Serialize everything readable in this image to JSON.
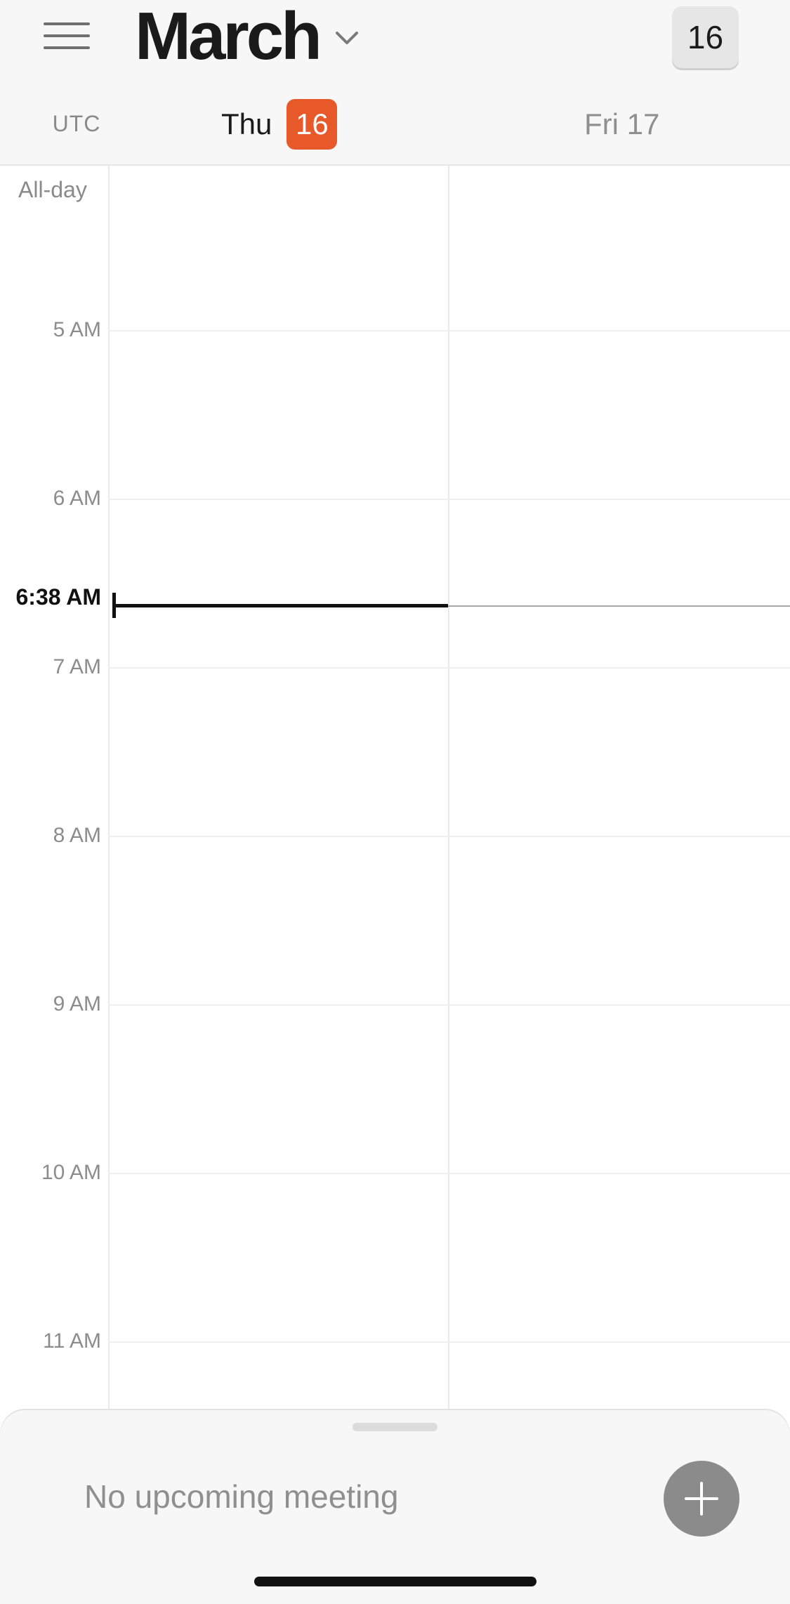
{
  "header": {
    "month": "March",
    "today_button": "16",
    "timezone": "UTC",
    "days": [
      {
        "name": "Thu",
        "date": "16",
        "is_today": true
      },
      {
        "label": "Fri 17",
        "is_today": false
      }
    ]
  },
  "allday": {
    "label": "All-day"
  },
  "timeline": {
    "hours": [
      "5 AM",
      "6 AM",
      "7 AM",
      "8 AM",
      "9 AM",
      "10 AM",
      "11 AM"
    ],
    "current_time": "6:38 AM"
  },
  "sheet": {
    "message": "No upcoming meeting"
  },
  "colors": {
    "accent": "#e8592a",
    "add_button": "#8b8b8b"
  },
  "icons": {
    "menu": "hamburger-menu-icon",
    "month_dropdown": "chevron-down-icon",
    "add": "plus-icon"
  }
}
